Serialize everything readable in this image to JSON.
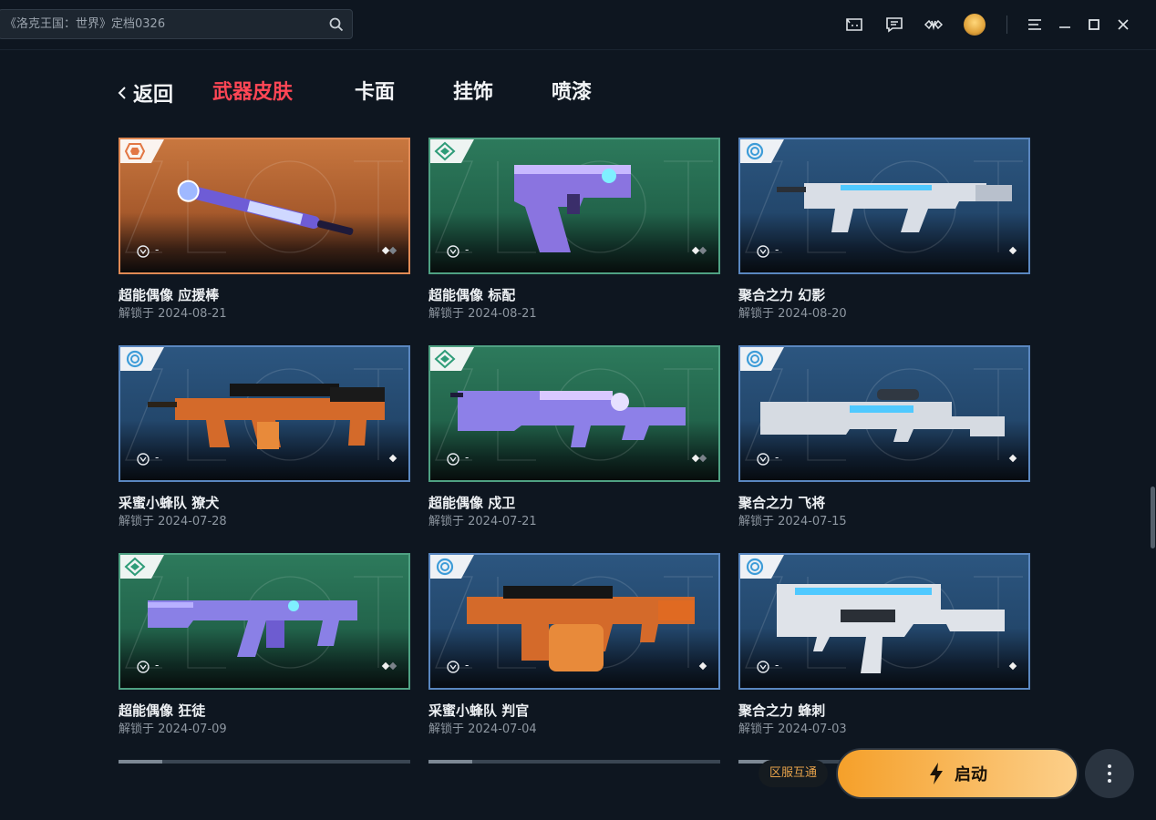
{
  "search": {
    "placeholder": "《洛克王国：世界》定档0326"
  },
  "tabs": {
    "back": "返回",
    "items": [
      "武器皮肤",
      "卡面",
      "挂饰",
      "喷漆"
    ],
    "active": 0
  },
  "cards": [
    {
      "name": "超能偶像 应援棒",
      "date": "解锁于 2024-08-21",
      "rank": "-",
      "tier": "orange"
    },
    {
      "name": "超能偶像 标配",
      "date": "解锁于 2024-08-21",
      "rank": "-",
      "tier": "green"
    },
    {
      "name": "聚合之力 幻影",
      "date": "解锁于 2024-08-20",
      "rank": "-",
      "tier": "blue"
    },
    {
      "name": "采蜜小蜂队 獠犬",
      "date": "解锁于 2024-07-28",
      "rank": "-",
      "tier": "blue"
    },
    {
      "name": "超能偶像 戍卫",
      "date": "解锁于 2024-07-21",
      "rank": "-",
      "tier": "green"
    },
    {
      "name": "聚合之力 飞将",
      "date": "解锁于 2024-07-15",
      "rank": "-",
      "tier": "blue"
    },
    {
      "name": "超能偶像 狂徒",
      "date": "解锁于 2024-07-09",
      "rank": "-",
      "tier": "green"
    },
    {
      "name": "采蜜小蜂队 判官",
      "date": "解锁于 2024-07-04",
      "rank": "-",
      "tier": "blue"
    },
    {
      "name": "聚合之力 蜂刺",
      "date": "解锁于 2024-07-03",
      "rank": "-",
      "tier": "blue"
    }
  ],
  "bottom": {
    "region": "区服互通",
    "launch": "启动"
  },
  "colors": {
    "accent": "#ff4655",
    "launch": "#f5a02a",
    "orange_tier": "#e08a55",
    "green_tier": "#4fa183",
    "blue_tier": "#5a87c0"
  },
  "icons": [
    "search-icon",
    "mailbox-icon",
    "chat-icon",
    "valorant-icon",
    "menu-icon",
    "minimize-icon",
    "maximize-icon",
    "close-icon",
    "bolt-icon",
    "more-icon"
  ]
}
